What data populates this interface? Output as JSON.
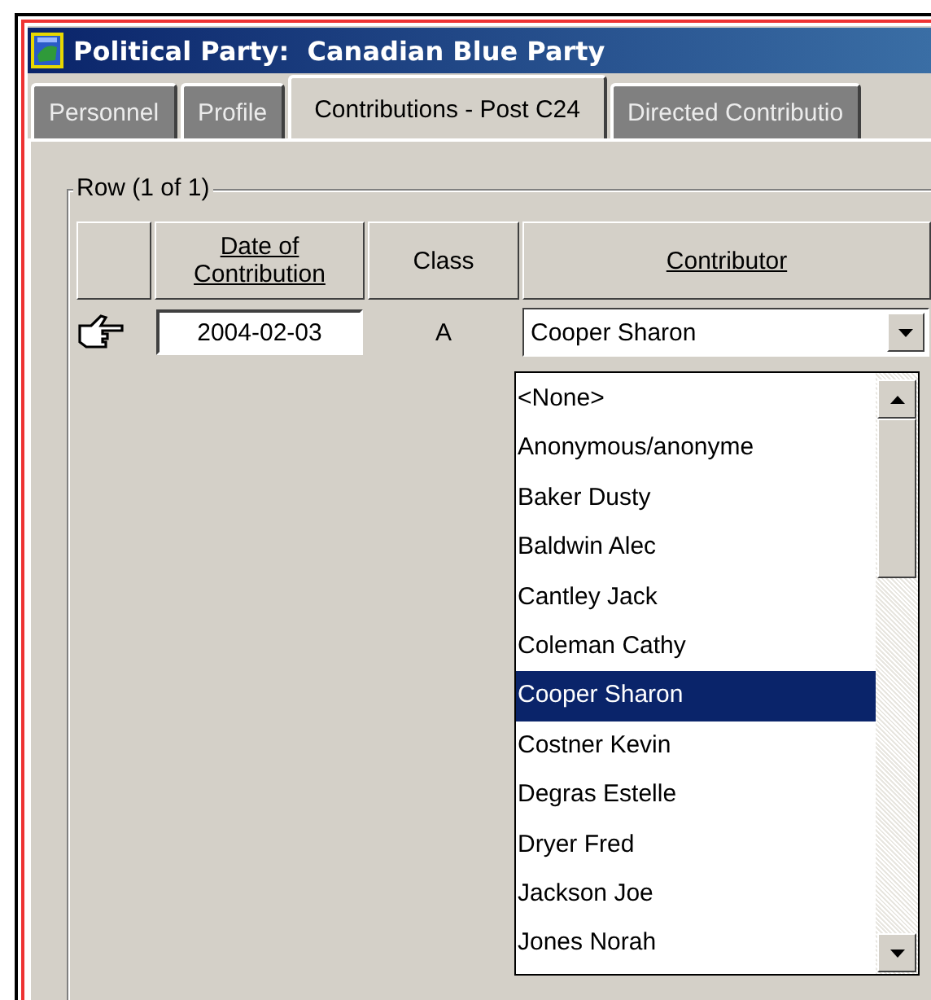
{
  "window": {
    "title": "Political Party:  Canadian Blue Party"
  },
  "tabs": [
    {
      "label": "Personnel",
      "selected": false
    },
    {
      "label": "Profile",
      "selected": false
    },
    {
      "label": "Contributions - Post C24",
      "selected": true
    },
    {
      "label": "Directed Contributio",
      "selected": false
    }
  ],
  "group": {
    "title": "Row (1 of 1)"
  },
  "table": {
    "columns": [
      {
        "label": "Date of Contribution",
        "underlined": true
      },
      {
        "label": "Class",
        "underlined": false
      },
      {
        "label": "Contributor",
        "underlined": true
      }
    ],
    "rows": [
      {
        "current": true,
        "date": "2004-02-03",
        "class": "A",
        "contributor": "Cooper Sharon"
      }
    ]
  },
  "dropdown": {
    "expanded": true,
    "options": [
      {
        "label": "<None>",
        "selected": false
      },
      {
        "label": "Anonymous/anonyme",
        "selected": false
      },
      {
        "label": "Baker Dusty",
        "selected": false
      },
      {
        "label": "Baldwin Alec",
        "selected": false
      },
      {
        "label": "Cantley Jack",
        "selected": false
      },
      {
        "label": "Coleman Cathy",
        "selected": false
      },
      {
        "label": "Cooper Sharon",
        "selected": true
      },
      {
        "label": "Costner Kevin",
        "selected": false
      },
      {
        "label": "Degras Estelle",
        "selected": false
      },
      {
        "label": "Dryer Fred",
        "selected": false
      },
      {
        "label": "Jackson Joe",
        "selected": false
      },
      {
        "label": "Jones Norah",
        "selected": false
      }
    ]
  }
}
